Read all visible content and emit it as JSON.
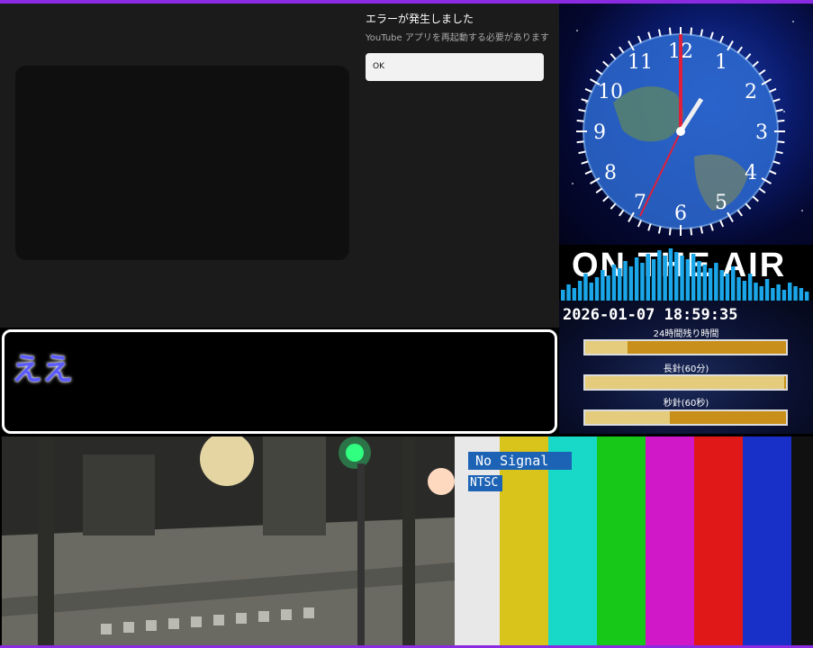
{
  "youtube_error": {
    "title": "エラーが発生しました",
    "message": "YouTube アプリを再起動する必要があります",
    "ok_label": "OK"
  },
  "message_box": {
    "text": "ええ"
  },
  "clock": {
    "numerals": [
      "12",
      "1",
      "2",
      "3",
      "4",
      "5",
      "6",
      "7",
      "8",
      "9",
      "10",
      "11"
    ],
    "time": "18:59:35"
  },
  "on_air": {
    "text": "ON THE AIR"
  },
  "time_panel": {
    "datetime": "2026-01-07 18:59:35",
    "remaining_label": "24時間残り時間",
    "remaining_fraction": 0.21,
    "minute_label": "長針(60分)",
    "minute_fraction": 0.99,
    "second_label": "秒針(60秒)",
    "second_fraction": 0.42
  },
  "test_pattern": {
    "no_signal_label": "No Signal",
    "format_label": "NTSC",
    "bar_colors": [
      "#e8e8e8",
      "#d8c41a",
      "#18d8c8",
      "#18c818",
      "#d018c8",
      "#e01818",
      "#1830c8",
      "#101010"
    ]
  },
  "colors": {
    "frame": "#8a2be2",
    "message_text": "#5b5bff",
    "no_signal_bg": "#1d63b5"
  }
}
